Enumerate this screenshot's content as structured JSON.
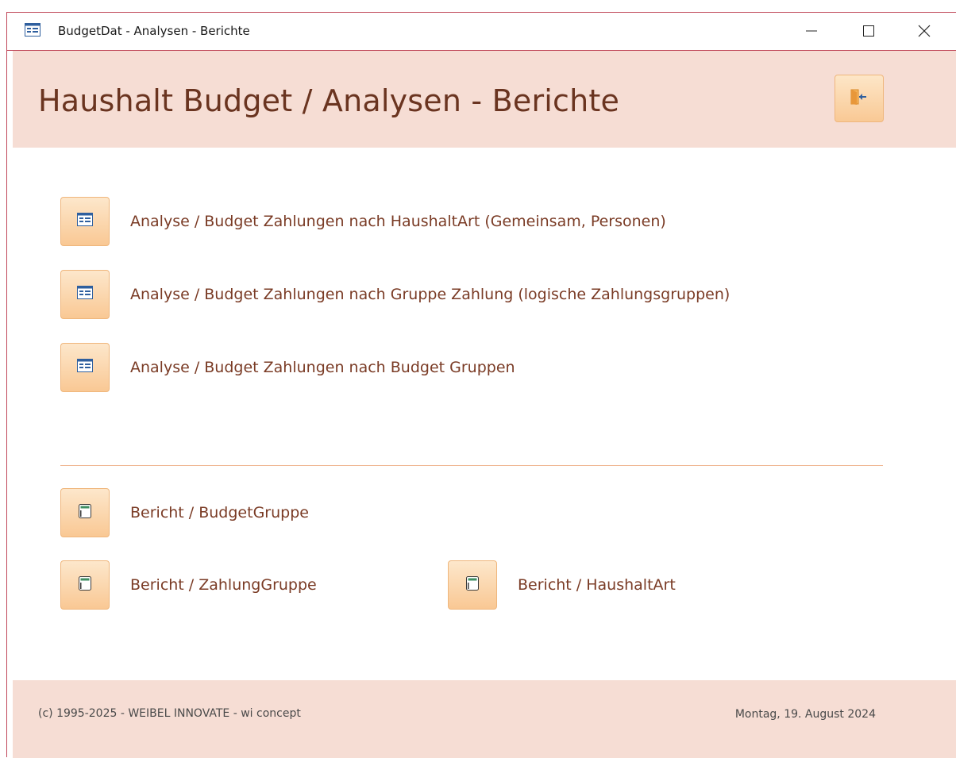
{
  "window": {
    "title": "BudgetDat - Analysen - Berichte",
    "app_icon": "form-icon",
    "controls": {
      "minimize": "minimize-icon",
      "maximize": "maximize-icon",
      "close": "close-icon"
    }
  },
  "header": {
    "title": "Haushalt Budget / Analysen - Berichte",
    "exit_icon": "exit-door-icon"
  },
  "analyses": [
    {
      "label": "Analyse / Budget Zahlungen nach HaushaltArt (Gemeinsam, Personen)",
      "icon": "form-icon"
    },
    {
      "label": "Analyse / Budget Zahlungen nach Gruppe Zahlung (logische Zahlungsgruppen)",
      "icon": "form-icon"
    },
    {
      "label": "Analyse / Budget Zahlungen nach Budget Gruppen",
      "icon": "form-icon"
    }
  ],
  "reports": [
    {
      "label": "Bericht / BudgetGruppe",
      "icon": "report-icon"
    },
    {
      "label": "Bericht / ZahlungGruppe",
      "icon": "report-icon"
    },
    {
      "label": "Bericht / HaushaltArt",
      "icon": "report-icon"
    }
  ],
  "footer": {
    "copyright": "(c) 1995-2025 - WEIBEL INNOVATE - wi concept",
    "date": "Montag, 19. August 2024"
  },
  "colors": {
    "accent_border": "#c0485a",
    "header_bg": "#f6ddd4",
    "title_text": "#6a3420",
    "button_top": "#fde7cb",
    "button_bottom": "#f9c894",
    "label_text": "#7a3b25"
  }
}
